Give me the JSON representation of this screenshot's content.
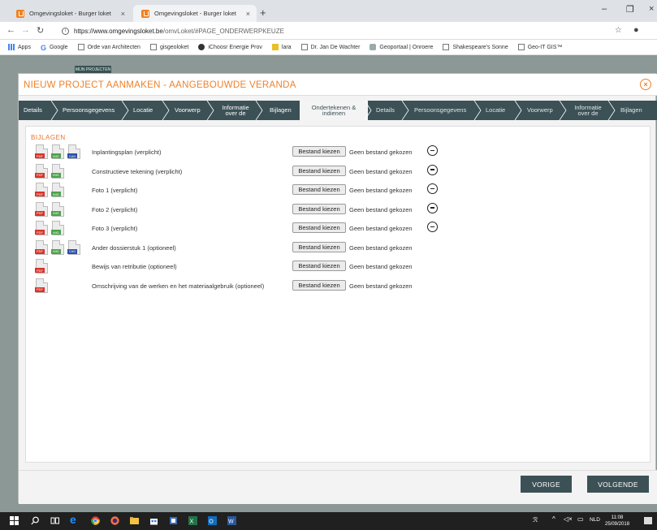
{
  "browser": {
    "tabs": [
      {
        "label": "Omgevingsloket - Burger loket",
        "active": false
      },
      {
        "label": "Omgevingsloket - Burger loket",
        "active": true
      }
    ],
    "url_host": "https://www.omgevingsloket.be",
    "url_path": "/omvLoket/#PAGE_ONDERWERPKEUZE",
    "bookmarks": [
      {
        "label": "Apps",
        "icon": "apps-icon"
      },
      {
        "label": "Google",
        "icon": "google-icon"
      },
      {
        "label": "Orde van Architecten",
        "icon": "page-icon"
      },
      {
        "label": "gisgeoloket",
        "icon": "page-icon"
      },
      {
        "label": "iChoosr Energie Prov",
        "icon": "ichoosr-icon"
      },
      {
        "label": "lara",
        "icon": "folder-icon"
      },
      {
        "label": "Dr. Jan De Wachter",
        "icon": "page-icon"
      },
      {
        "label": "Geoportaal | Onroere",
        "icon": "geoportaal-icon"
      },
      {
        "label": "Shakespeare's Sonne",
        "icon": "page-icon"
      },
      {
        "label": "Geo-IT GIS™",
        "icon": "page-icon"
      }
    ]
  },
  "app": {
    "projects_button": "MIJN PROJECTEN",
    "modal_title": "NIEUW PROJECT AANMAKEN - AANGEBOUWDE VERANDA",
    "steps": [
      {
        "label": "Details"
      },
      {
        "label": "Persoonsgegevens"
      },
      {
        "label": "Locatie"
      },
      {
        "label": "Voorwerp"
      },
      {
        "label": "Informatie over de"
      },
      {
        "label": "Bijlagen"
      },
      {
        "label": "Ondertekenen & indienen"
      },
      {
        "label": "Details"
      },
      {
        "label": "Persoonsgegevens"
      },
      {
        "label": "Locatie"
      },
      {
        "label": "Voorwerp"
      },
      {
        "label": "Informatie over de"
      },
      {
        "label": "Bijlagen"
      }
    ],
    "section_title": "BIJLAGEN",
    "file_button_label": "Bestand kiezen",
    "no_file_label": "Geen bestand gekozen",
    "attachments": [
      {
        "label": "Inplantingsplan (verplicht)",
        "types": [
          "PDF",
          "IMG",
          "CAD"
        ],
        "removable": true
      },
      {
        "label": "Constructieve tekening (verplicht)",
        "types": [
          "PDF",
          "IMG"
        ],
        "removable": true
      },
      {
        "label": "Foto 1 (verplicht)",
        "types": [
          "PDF",
          "IMG"
        ],
        "removable": true
      },
      {
        "label": "Foto 2 (verplicht)",
        "types": [
          "PDF",
          "IMG"
        ],
        "removable": true
      },
      {
        "label": "Foto 3 (verplicht)",
        "types": [
          "PDF",
          "IMG"
        ],
        "removable": true
      },
      {
        "label": "Ander dossierstuk 1 (optioneel)",
        "types": [
          "PDF",
          "IMG",
          "CAD"
        ],
        "removable": false
      },
      {
        "label": "Bewijs van retributie (optioneel)",
        "types": [
          "PDF"
        ],
        "removable": false
      },
      {
        "label": "Omschrijving van de werken en het materiaalgebruik (optioneel)",
        "types": [
          "PDF"
        ],
        "removable": false
      }
    ],
    "footer": {
      "prev": "VORIGE",
      "next": "VOLGENDE"
    }
  },
  "taskbar": {
    "lang": "NLD",
    "time": "11:08",
    "date": "25/09/2018"
  },
  "colors": {
    "accent_orange": "#f0812a",
    "nav_dark": "#3c5156",
    "page_bg": "#8c9896"
  }
}
